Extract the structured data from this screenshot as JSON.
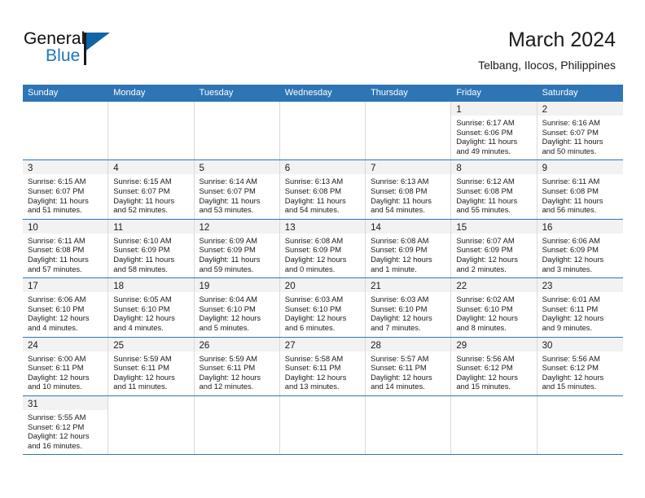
{
  "brand": {
    "name_top": "General",
    "name_bottom": "Blue",
    "accent_color": "#1f76bc",
    "flag_color": "#1064a8",
    "logo_icon": "flag-triangle-icon"
  },
  "header": {
    "title": "March 2024",
    "subtitle": "Telbang, Ilocos, Philippines"
  },
  "theme": {
    "header_bg": "#2e75b6",
    "header_text": "#ffffff",
    "datebar_bg": "#f2f2f2",
    "row_border": "#2e75b6",
    "cell_border": "#d9d9d9"
  },
  "weekdays": [
    "Sunday",
    "Monday",
    "Tuesday",
    "Wednesday",
    "Thursday",
    "Friday",
    "Saturday"
  ],
  "labels": {
    "sunrise": "Sunrise:",
    "sunset": "Sunset:",
    "daylight": "Daylight:"
  },
  "weeks": [
    [
      {
        "blank": true
      },
      {
        "blank": true
      },
      {
        "blank": true
      },
      {
        "blank": true
      },
      {
        "blank": true
      },
      {
        "day": "1",
        "sunrise": "Sunrise: 6:17 AM",
        "sunset": "Sunset: 6:06 PM",
        "daylight_1": "Daylight: 11 hours",
        "daylight_2": "and 49 minutes."
      },
      {
        "day": "2",
        "sunrise": "Sunrise: 6:16 AM",
        "sunset": "Sunset: 6:07 PM",
        "daylight_1": "Daylight: 11 hours",
        "daylight_2": "and 50 minutes."
      }
    ],
    [
      {
        "day": "3",
        "sunrise": "Sunrise: 6:15 AM",
        "sunset": "Sunset: 6:07 PM",
        "daylight_1": "Daylight: 11 hours",
        "daylight_2": "and 51 minutes."
      },
      {
        "day": "4",
        "sunrise": "Sunrise: 6:15 AM",
        "sunset": "Sunset: 6:07 PM",
        "daylight_1": "Daylight: 11 hours",
        "daylight_2": "and 52 minutes."
      },
      {
        "day": "5",
        "sunrise": "Sunrise: 6:14 AM",
        "sunset": "Sunset: 6:07 PM",
        "daylight_1": "Daylight: 11 hours",
        "daylight_2": "and 53 minutes."
      },
      {
        "day": "6",
        "sunrise": "Sunrise: 6:13 AM",
        "sunset": "Sunset: 6:08 PM",
        "daylight_1": "Daylight: 11 hours",
        "daylight_2": "and 54 minutes."
      },
      {
        "day": "7",
        "sunrise": "Sunrise: 6:13 AM",
        "sunset": "Sunset: 6:08 PM",
        "daylight_1": "Daylight: 11 hours",
        "daylight_2": "and 54 minutes."
      },
      {
        "day": "8",
        "sunrise": "Sunrise: 6:12 AM",
        "sunset": "Sunset: 6:08 PM",
        "daylight_1": "Daylight: 11 hours",
        "daylight_2": "and 55 minutes."
      },
      {
        "day": "9",
        "sunrise": "Sunrise: 6:11 AM",
        "sunset": "Sunset: 6:08 PM",
        "daylight_1": "Daylight: 11 hours",
        "daylight_2": "and 56 minutes."
      }
    ],
    [
      {
        "day": "10",
        "sunrise": "Sunrise: 6:11 AM",
        "sunset": "Sunset: 6:08 PM",
        "daylight_1": "Daylight: 11 hours",
        "daylight_2": "and 57 minutes."
      },
      {
        "day": "11",
        "sunrise": "Sunrise: 6:10 AM",
        "sunset": "Sunset: 6:09 PM",
        "daylight_1": "Daylight: 11 hours",
        "daylight_2": "and 58 minutes."
      },
      {
        "day": "12",
        "sunrise": "Sunrise: 6:09 AM",
        "sunset": "Sunset: 6:09 PM",
        "daylight_1": "Daylight: 11 hours",
        "daylight_2": "and 59 minutes."
      },
      {
        "day": "13",
        "sunrise": "Sunrise: 6:08 AM",
        "sunset": "Sunset: 6:09 PM",
        "daylight_1": "Daylight: 12 hours",
        "daylight_2": "and 0 minutes."
      },
      {
        "day": "14",
        "sunrise": "Sunrise: 6:08 AM",
        "sunset": "Sunset: 6:09 PM",
        "daylight_1": "Daylight: 12 hours",
        "daylight_2": "and 1 minute."
      },
      {
        "day": "15",
        "sunrise": "Sunrise: 6:07 AM",
        "sunset": "Sunset: 6:09 PM",
        "daylight_1": "Daylight: 12 hours",
        "daylight_2": "and 2 minutes."
      },
      {
        "day": "16",
        "sunrise": "Sunrise: 6:06 AM",
        "sunset": "Sunset: 6:09 PM",
        "daylight_1": "Daylight: 12 hours",
        "daylight_2": "and 3 minutes."
      }
    ],
    [
      {
        "day": "17",
        "sunrise": "Sunrise: 6:06 AM",
        "sunset": "Sunset: 6:10 PM",
        "daylight_1": "Daylight: 12 hours",
        "daylight_2": "and 4 minutes."
      },
      {
        "day": "18",
        "sunrise": "Sunrise: 6:05 AM",
        "sunset": "Sunset: 6:10 PM",
        "daylight_1": "Daylight: 12 hours",
        "daylight_2": "and 4 minutes."
      },
      {
        "day": "19",
        "sunrise": "Sunrise: 6:04 AM",
        "sunset": "Sunset: 6:10 PM",
        "daylight_1": "Daylight: 12 hours",
        "daylight_2": "and 5 minutes."
      },
      {
        "day": "20",
        "sunrise": "Sunrise: 6:03 AM",
        "sunset": "Sunset: 6:10 PM",
        "daylight_1": "Daylight: 12 hours",
        "daylight_2": "and 6 minutes."
      },
      {
        "day": "21",
        "sunrise": "Sunrise: 6:03 AM",
        "sunset": "Sunset: 6:10 PM",
        "daylight_1": "Daylight: 12 hours",
        "daylight_2": "and 7 minutes."
      },
      {
        "day": "22",
        "sunrise": "Sunrise: 6:02 AM",
        "sunset": "Sunset: 6:10 PM",
        "daylight_1": "Daylight: 12 hours",
        "daylight_2": "and 8 minutes."
      },
      {
        "day": "23",
        "sunrise": "Sunrise: 6:01 AM",
        "sunset": "Sunset: 6:11 PM",
        "daylight_1": "Daylight: 12 hours",
        "daylight_2": "and 9 minutes."
      }
    ],
    [
      {
        "day": "24",
        "sunrise": "Sunrise: 6:00 AM",
        "sunset": "Sunset: 6:11 PM",
        "daylight_1": "Daylight: 12 hours",
        "daylight_2": "and 10 minutes."
      },
      {
        "day": "25",
        "sunrise": "Sunrise: 5:59 AM",
        "sunset": "Sunset: 6:11 PM",
        "daylight_1": "Daylight: 12 hours",
        "daylight_2": "and 11 minutes."
      },
      {
        "day": "26",
        "sunrise": "Sunrise: 5:59 AM",
        "sunset": "Sunset: 6:11 PM",
        "daylight_1": "Daylight: 12 hours",
        "daylight_2": "and 12 minutes."
      },
      {
        "day": "27",
        "sunrise": "Sunrise: 5:58 AM",
        "sunset": "Sunset: 6:11 PM",
        "daylight_1": "Daylight: 12 hours",
        "daylight_2": "and 13 minutes."
      },
      {
        "day": "28",
        "sunrise": "Sunrise: 5:57 AM",
        "sunset": "Sunset: 6:11 PM",
        "daylight_1": "Daylight: 12 hours",
        "daylight_2": "and 14 minutes."
      },
      {
        "day": "29",
        "sunrise": "Sunrise: 5:56 AM",
        "sunset": "Sunset: 6:12 PM",
        "daylight_1": "Daylight: 12 hours",
        "daylight_2": "and 15 minutes."
      },
      {
        "day": "30",
        "sunrise": "Sunrise: 5:56 AM",
        "sunset": "Sunset: 6:12 PM",
        "daylight_1": "Daylight: 12 hours",
        "daylight_2": "and 15 minutes."
      }
    ],
    [
      {
        "day": "31",
        "sunrise": "Sunrise: 5:55 AM",
        "sunset": "Sunset: 6:12 PM",
        "daylight_1": "Daylight: 12 hours",
        "daylight_2": "and 16 minutes."
      },
      {
        "blank": true
      },
      {
        "blank": true
      },
      {
        "blank": true
      },
      {
        "blank": true
      },
      {
        "blank": true
      },
      {
        "blank": true
      }
    ]
  ]
}
